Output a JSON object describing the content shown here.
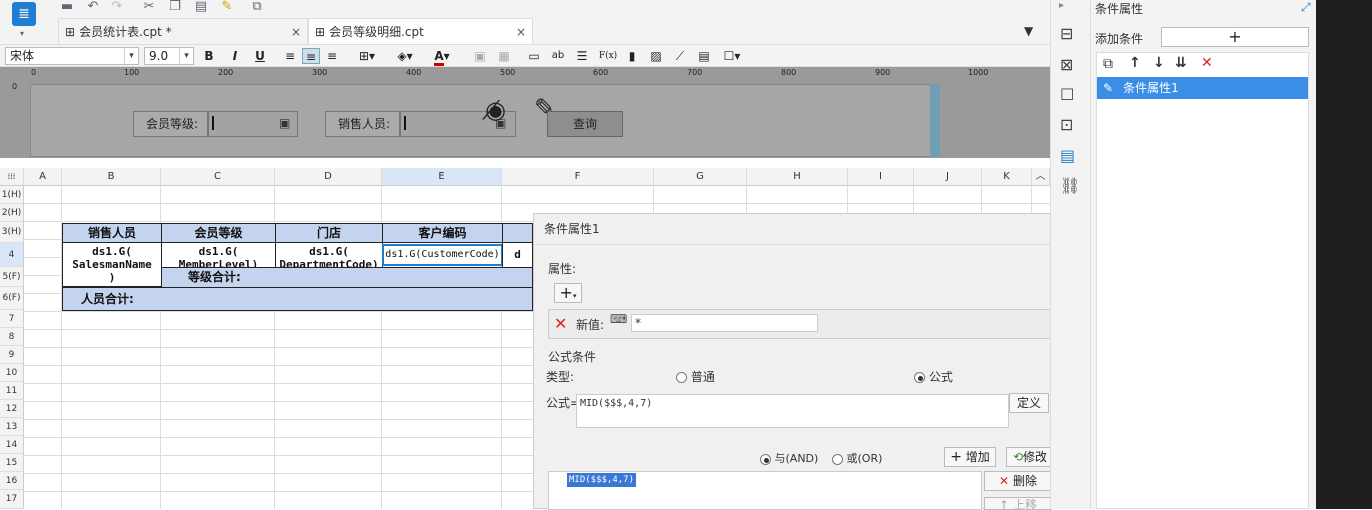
{
  "tabs": [
    {
      "label": "会员统计表.cpt *"
    },
    {
      "label": "会员等级明细.cpt"
    }
  ],
  "format": {
    "font": "宋体",
    "size": "9.0",
    "bold": "B",
    "italic": "I",
    "underline": "U",
    "text_color_letter": "A",
    "ab": "ab",
    "fx": "F(x)"
  },
  "ruler": [
    "0",
    "100",
    "200",
    "300",
    "400",
    "500",
    "600",
    "700",
    "800",
    "900",
    "1000"
  ],
  "ruler_side": "0",
  "params": {
    "member_level_label": "会员等级:",
    "sales_person_label": "销售人员:",
    "query_button": "查询"
  },
  "columns": [
    "A",
    "B",
    "C",
    "D",
    "E",
    "F",
    "G",
    "H",
    "I",
    "J",
    "K"
  ],
  "rows": [
    "1(H)",
    "2(H)",
    "3(H)",
    "4",
    "5(F)",
    "6(F)",
    "7",
    "8",
    "9",
    "10",
    "11",
    "12",
    "13",
    "14",
    "15",
    "16",
    "17"
  ],
  "report": {
    "headers": [
      "销售人员",
      "会员等级",
      "门店",
      "客户编码"
    ],
    "b4": "ds1.G(\nSalesmanName\n)",
    "c4": "ds1.G(\nMemberLevel)",
    "d4": "ds1.G(\nDepartmentCode)",
    "e4": "ds1.G(CustomerCode)",
    "f4": "d",
    "level_total": "等级合计:",
    "person_total": "人员合计:"
  },
  "cond_panel": {
    "title": "条件属性1",
    "attr_label": "属性:",
    "add_plus": "+",
    "new_value_label": "新值:",
    "new_value": "*",
    "formula_section": "公式条件",
    "type_label": "类型:",
    "type_normal": "普通",
    "type_formula": "公式",
    "formula_label": "公式=",
    "formula_value": "MID($$$,4,7)",
    "define_button": "定义",
    "and_label": "与(AND)",
    "or_label": "或(OR)",
    "add_button": "增加",
    "modify_button": "修改",
    "list_item": "MID($$$,4,7)",
    "delete_button": "删除",
    "move_up_button": "上移"
  },
  "right_panel": {
    "title": "条件属性",
    "add_condition": "添加条件",
    "add_plus": "+",
    "item": "条件属性1"
  }
}
